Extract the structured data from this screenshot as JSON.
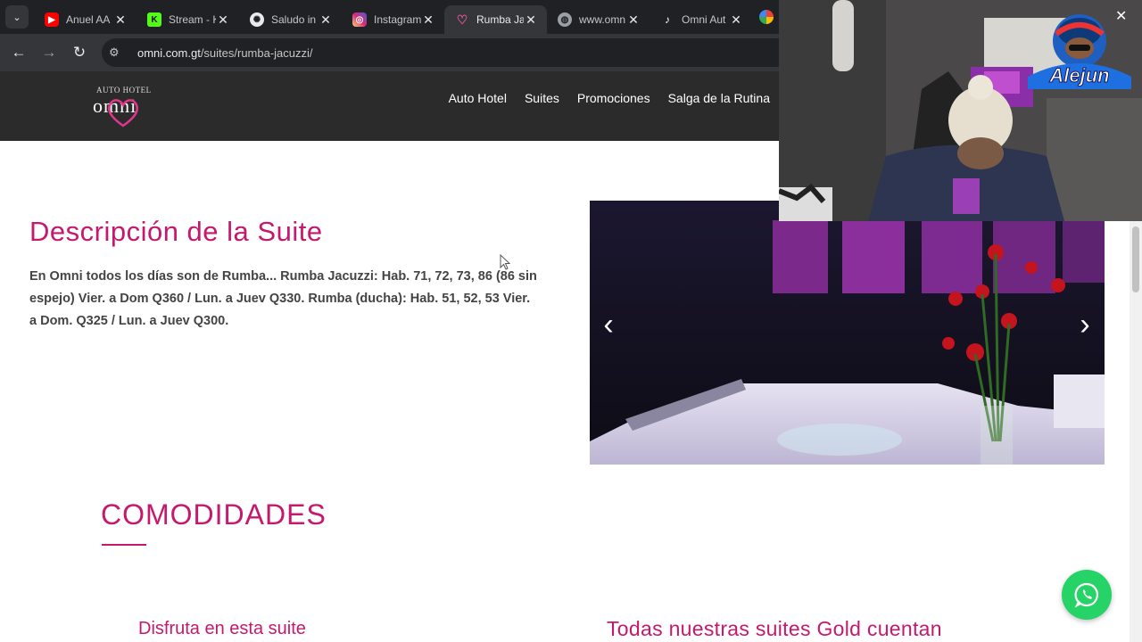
{
  "browser": {
    "tabs": [
      {
        "title": "Anuel AA",
        "icon": "youtube-icon",
        "color": "#ff0000"
      },
      {
        "title": "Stream - K",
        "icon": "kick-icon",
        "color": "#53fc18"
      },
      {
        "title": "Saludo in",
        "icon": "openai-icon",
        "color": "#9aa0a6"
      },
      {
        "title": "Instagram",
        "icon": "instagram-icon",
        "color": "#e1306c"
      },
      {
        "title": "Rumba Ja",
        "icon": "omni-heart-icon",
        "color": "#c5196d"
      },
      {
        "title": "www.omn",
        "icon": "globe-icon",
        "color": "#9aa0a6"
      },
      {
        "title": "Omni Aut",
        "icon": "tiktok-icon",
        "color": "#000000"
      }
    ],
    "active_tab": 4,
    "url_host": "omni.com.gt",
    "url_path": "/suites/rumba-jacuzzi/"
  },
  "site": {
    "logo_small": "AUTO HOTEL",
    "logo_name": "omni",
    "nav": [
      "Auto Hotel",
      "Suites",
      "Promociones",
      "Salga de la Rutina"
    ]
  },
  "content": {
    "title": "Descripción de la Suite",
    "description": "En Omni todos los días son de Rumba... Rumba Jacuzzi: Hab. 71, 72, 73, 86 (86 sin espejo) Vier. a Dom Q360 / Lun. a Juev Q330. Rumba (ducha): Hab. 51, 52, 53 Vier. a Dom. Q325 / Lun. a Juev Q300.",
    "amenities_title": "COMODIDADES",
    "sub_left": "Disfruta en esta suite",
    "sub_right": "Todas nuestras suites Gold cuentan"
  },
  "slider": {
    "prev": "‹",
    "next": "›"
  },
  "webcam": {
    "overlay_text": "Alejun"
  },
  "colors": {
    "accent": "#c5196d",
    "header_bg": "#2b2b2b",
    "whatsapp": "#25d366"
  }
}
